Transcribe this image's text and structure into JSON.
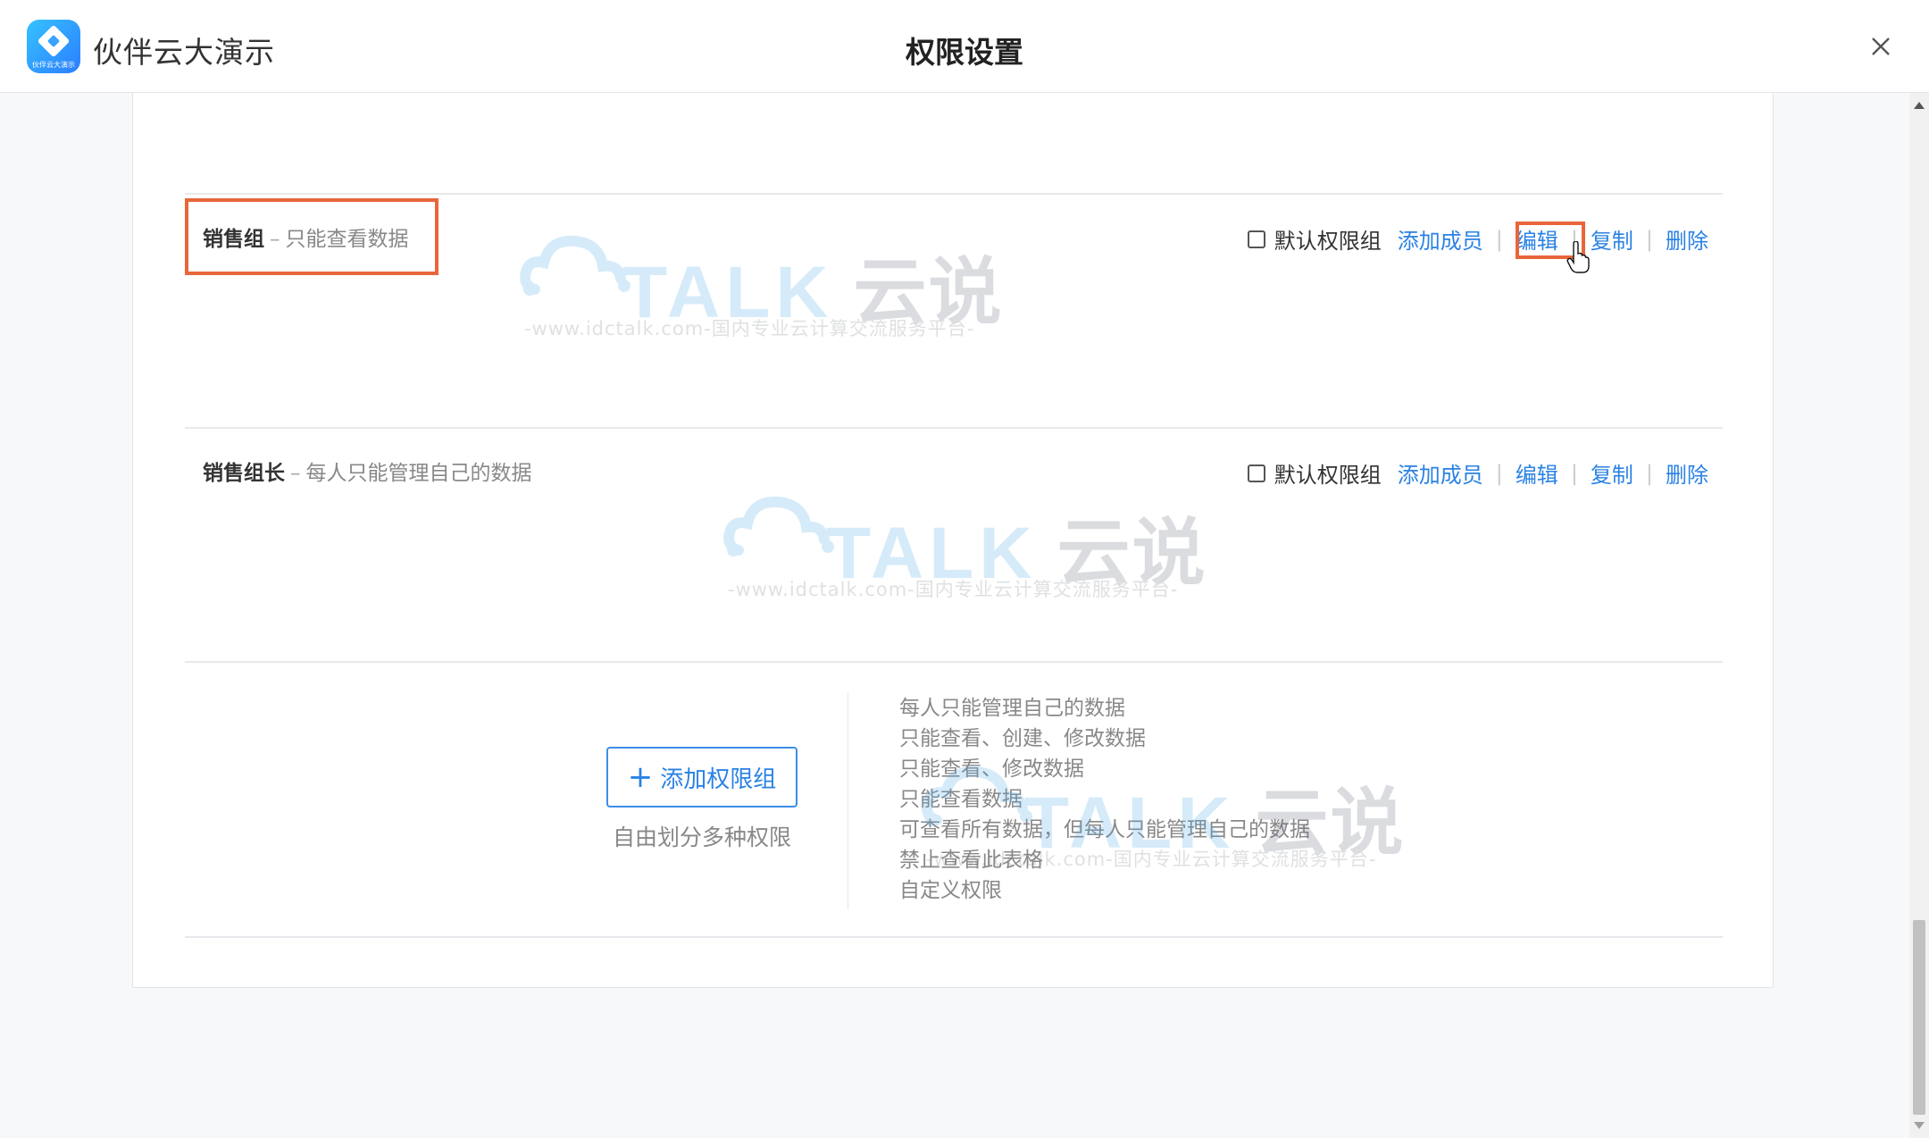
{
  "header": {
    "app_name": "伙伴云大演示",
    "logo_caption": "伙伴云大演示",
    "title": "权限设置",
    "close_icon": "close-icon"
  },
  "groups": [
    {
      "name": "销售组",
      "separator": "–",
      "description": "只能查看数据",
      "default_label": "默认权限组",
      "default_checked": false,
      "actions": [
        "添加成员",
        "编辑",
        "复制",
        "删除"
      ],
      "separator_bar": "|"
    },
    {
      "name": "销售组长",
      "separator": "–",
      "description": "每人只能管理自己的数据",
      "default_label": "默认权限组",
      "default_checked": false,
      "actions": [
        "添加成员",
        "编辑",
        "复制",
        "删除"
      ],
      "separator_bar": "|"
    }
  ],
  "add_section": {
    "button_label": "添加权限组",
    "button_icon": "plus-icon",
    "subtitle": "自由划分多种权限",
    "permission_types": [
      "每人只能管理自己的数据",
      "只能查看、创建、修改数据",
      "只能查看、修改数据",
      "只能查看数据",
      "可查看所有数据，但每人只能管理自己的数据",
      "禁止查看此表格",
      "自定义权限"
    ]
  },
  "watermark": {
    "brand": "TALK",
    "brand_cn": "云说",
    "tagline": "-www.idctalk.com-国内专业云计算交流服务平台-"
  },
  "colors": {
    "link": "#2a82e4",
    "highlight": "#e8663b",
    "logo_gradient_start": "#36c2ff",
    "logo_gradient_end": "#2b7dff"
  }
}
